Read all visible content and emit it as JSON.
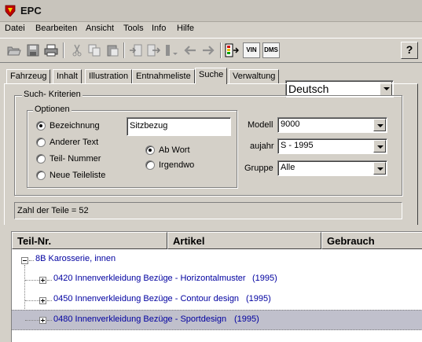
{
  "window": {
    "title": "EPC"
  },
  "menu": [
    "Datei",
    "Bearbeiten",
    "Ansicht",
    "Tools",
    "Info",
    "Hilfe"
  ],
  "toolbar": {
    "language": "Deutsch",
    "vin_label": "VIN",
    "dms_label": "DMS",
    "help_label": "?"
  },
  "tabs": [
    "Fahrzeug",
    "Inhalt",
    "Illustration",
    "Entnahmeliste",
    "Suche",
    "Verwaltung"
  ],
  "active_tab": "Suche",
  "search": {
    "group_label": "Such- Kriterien",
    "options_label": "Optionen",
    "options": [
      {
        "label": "Bezeichnung",
        "checked": true
      },
      {
        "label": "Anderer Text",
        "checked": false
      },
      {
        "label": "Teil- Nummer",
        "checked": false
      },
      {
        "label": "Neue Teileliste",
        "checked": false
      }
    ],
    "text_value": "Sitzbezug",
    "match_options": [
      {
        "label": "Ab Wort",
        "checked": true
      },
      {
        "label": "Irgendwo",
        "checked": false
      }
    ],
    "fields": [
      {
        "label": "Modell",
        "value": "9000"
      },
      {
        "label": "aujahr",
        "value": "S - 1995"
      },
      {
        "label": "Gruppe",
        "value": "Alle"
      }
    ],
    "status": "Zahl der Teile = 52"
  },
  "results": {
    "columns": [
      "Teil-Nr.",
      "Artikel",
      "Gebrauch"
    ],
    "root": "8B Karosserie, innen",
    "items": [
      {
        "text": "0420 Innenverkleidung  Bezüge - Horizontalmuster",
        "year": "(1995)",
        "selected": false
      },
      {
        "text": "0450 Innenverkleidung  Bezüge - Contour design",
        "year": "(1995)",
        "selected": false
      },
      {
        "text": "0480 Innenverkleidung  Bezüge - Sportdesign",
        "year": "(1995)",
        "selected": true
      }
    ]
  },
  "colors": {
    "tree_text": "#0000a0",
    "selection": "#c0c0cc",
    "face": "#d4d0c8"
  }
}
